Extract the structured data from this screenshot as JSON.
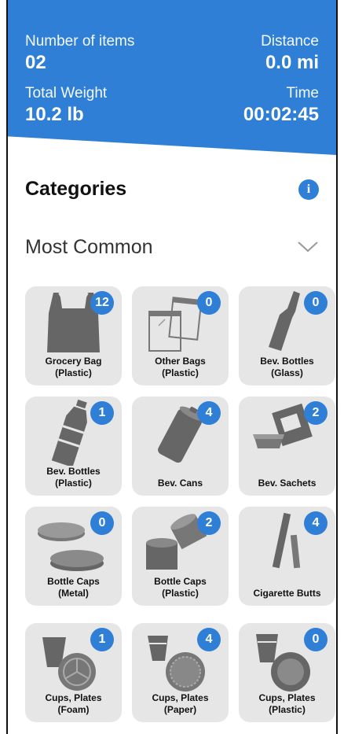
{
  "stats": {
    "items_label": "Number of items",
    "items_value": "02",
    "distance_label": "Distance",
    "distance_value": "0.0 mi",
    "weight_label": "Total Weight",
    "weight_value": "10.2 lb",
    "time_label": "Time",
    "time_value": "00:02:45"
  },
  "categories_title": "Categories",
  "info_icon": "i",
  "section": {
    "label": "Most Common",
    "icon": "chevron-down-icon"
  },
  "tiles": [
    {
      "line1": "Grocery Bag",
      "line2": "(Plastic)",
      "count": "12",
      "icon": "grocery-bag-icon"
    },
    {
      "line1": "Other Bags",
      "line2": "(Plastic)",
      "count": "0",
      "icon": "other-bags-icon"
    },
    {
      "line1": "Bev. Bottles",
      "line2": "(Glass)",
      "count": "0",
      "icon": "glass-bottle-icon"
    },
    {
      "line1": "Bev. Bottles",
      "line2": "(Plastic)",
      "count": "1",
      "icon": "plastic-bottle-icon"
    },
    {
      "line1": "Bev. Cans",
      "line2": "",
      "count": "4",
      "icon": "can-icon"
    },
    {
      "line1": "Bev. Sachets",
      "line2": "",
      "count": "2",
      "icon": "sachet-icon"
    },
    {
      "line1": "Bottle Caps",
      "line2": "(Metal)",
      "count": "0",
      "icon": "metal-caps-icon"
    },
    {
      "line1": "Bottle Caps",
      "line2": "(Plastic)",
      "count": "2",
      "icon": "plastic-caps-icon"
    },
    {
      "line1": "Cigarette Butts",
      "line2": "",
      "count": "4",
      "icon": "cigarette-icon"
    },
    {
      "line1": "Cups, Plates",
      "line2": "(Foam)",
      "count": "1",
      "icon": "foam-cup-plate-icon"
    },
    {
      "line1": "Cups, Plates",
      "line2": "(Paper)",
      "count": "4",
      "icon": "paper-cup-plate-icon"
    },
    {
      "line1": "Cups, Plates",
      "line2": "(Plastic)",
      "count": "0",
      "icon": "plastic-cup-plate-icon"
    }
  ],
  "colors": {
    "accent": "#2f7fd6",
    "tile_bg": "#e6e6e6",
    "icon_gray": "#666666"
  }
}
